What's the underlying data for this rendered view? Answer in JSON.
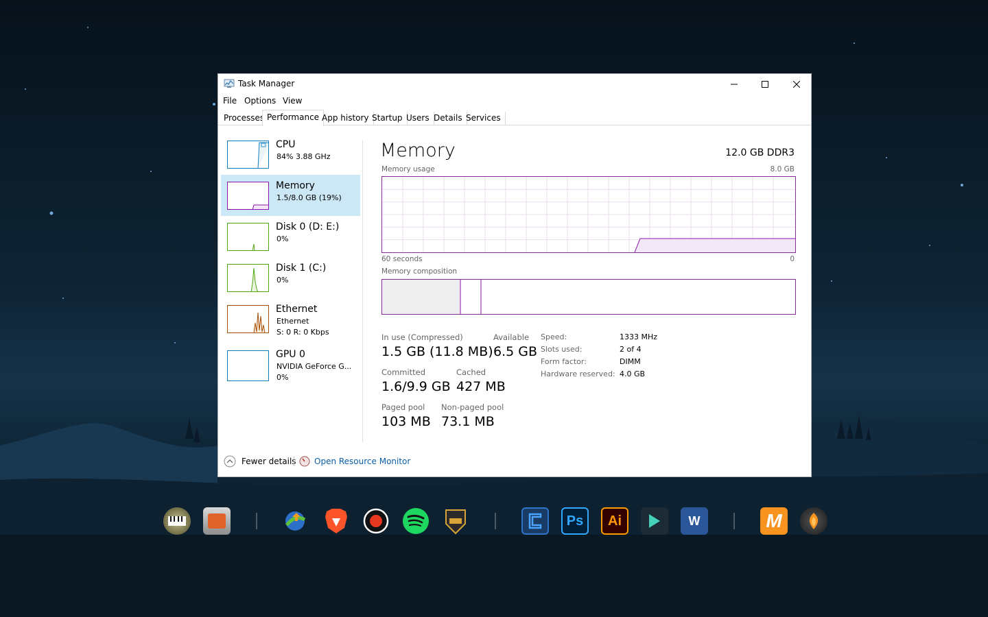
{
  "window": {
    "title": "Task Manager",
    "controls": {
      "minimize": "minimize",
      "maximize": "maximize",
      "close": "close"
    }
  },
  "menu": [
    "File",
    "Options",
    "View"
  ],
  "tabs": [
    "Processes",
    "Performance",
    "App history",
    "Startup",
    "Users",
    "Details",
    "Services"
  ],
  "active_tab": "Performance",
  "sidebar": [
    {
      "name": "CPU",
      "sub": "84%  3.88 GHz",
      "sub2": "",
      "color": "#117dbb"
    },
    {
      "name": "Memory",
      "sub": "1.5/8.0 GB (19%)",
      "sub2": "",
      "color": "#8b12ae"
    },
    {
      "name": "Disk 0 (D: E:)",
      "sub": "0%",
      "sub2": "",
      "color": "#4da60c"
    },
    {
      "name": "Disk 1 (C:)",
      "sub": "0%",
      "sub2": "",
      "color": "#4da60c"
    },
    {
      "name": "Ethernet",
      "sub": "Ethernet",
      "sub2": "S: 0  R: 0 Kbps",
      "color": "#a74f01"
    },
    {
      "name": "GPU 0",
      "sub": "NVIDIA GeForce G...",
      "sub2": "0%",
      "color": "#117dbb"
    }
  ],
  "main": {
    "title": "Memory",
    "spec": "12.0 GB DDR3",
    "usage_label": "Memory usage",
    "usage_max": "8.0 GB",
    "time_left": "60 seconds",
    "time_right": "0",
    "composition_label": "Memory composition",
    "accent": "#8b12ae",
    "stats": {
      "in_use_label": "In use (Compressed)",
      "in_use_value": "1.5 GB (11.8 MB)",
      "available_label": "Available",
      "available_value": "6.5 GB",
      "committed_label": "Committed",
      "committed_value": "1.6/9.9 GB",
      "cached_label": "Cached",
      "cached_value": "427 MB",
      "paged_label": "Paged pool",
      "paged_value": "103 MB",
      "nonpaged_label": "Non-paged pool",
      "nonpaged_value": "73.1 MB"
    },
    "details": [
      {
        "key": "Speed:",
        "value": "1333 MHz"
      },
      {
        "key": "Slots used:",
        "value": "2 of 4"
      },
      {
        "key": "Form factor:",
        "value": "DIMM"
      },
      {
        "key": "Hardware reserved:",
        "value": "4.0 GB"
      }
    ]
  },
  "footer": {
    "fewer_details": "Fewer details",
    "open_monitor": "Open Resource Monitor"
  },
  "dock": [
    {
      "icon": "piano-icon",
      "label": ""
    },
    {
      "icon": "box-app-icon",
      "label": ""
    },
    {
      "icon": "download-manager-icon",
      "label": ""
    },
    {
      "icon": "brave-icon",
      "label": ""
    },
    {
      "icon": "record-icon",
      "label": ""
    },
    {
      "icon": "spotify-icon",
      "label": ""
    },
    {
      "icon": "bull-logo-icon",
      "label": ""
    },
    {
      "icon": "blue-app-icon",
      "label": ""
    },
    {
      "icon": "photoshop-icon",
      "label": "Ps"
    },
    {
      "icon": "illustrator-icon",
      "label": "Ai"
    },
    {
      "icon": "filmora-icon",
      "label": ""
    },
    {
      "icon": "word-icon",
      "label": "W"
    },
    {
      "icon": "mixmeister-bpm-icon",
      "label": "M"
    },
    {
      "icon": "fl-studio-icon",
      "label": ""
    }
  ]
}
